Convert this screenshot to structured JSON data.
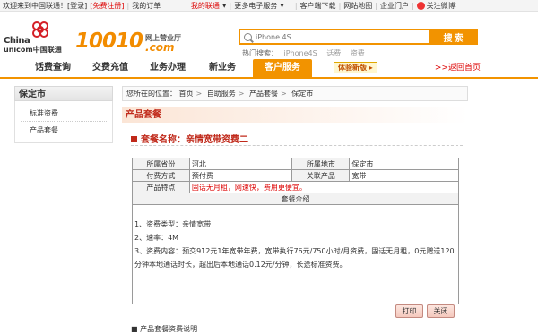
{
  "topbar": {
    "welcome": "欢迎来到中国联通！",
    "login": "[登录]",
    "register": "[免费注册]",
    "my_order": "我的订单",
    "my_unicom": "我的联通",
    "more_services": "更多电子服务",
    "client_download": "客户端下载",
    "sitemap": "网站地图",
    "enterprise": "企业门户",
    "weibo": "关注微博"
  },
  "header": {
    "logo_china": "China",
    "logo_unicom": "unicom中国联通",
    "brand_num": "10010",
    "brand_cn": "网上营业厅",
    "brand_com": ".com",
    "search_placeholder": "iPhone 4S",
    "search_button": "搜索",
    "hot_label": "热门搜索：",
    "hot_words": [
      "iPhone4S",
      "话费",
      "资费"
    ]
  },
  "nav": {
    "items": [
      "话费查询",
      "交费充值",
      "业务办理",
      "新业务",
      "客户服务"
    ],
    "active_index": 4,
    "promo": "体验新版 ▸",
    "back_home": ">>返回首页"
  },
  "sidebar": {
    "title": "保定市",
    "items": [
      "标准资费",
      "产品套餐"
    ]
  },
  "breadcrumb": {
    "prefix": "您所在的位置：",
    "items": [
      "首页",
      "自助服务",
      "产品套餐",
      "保定市"
    ]
  },
  "section": {
    "title": "产品套餐",
    "package_name": "套餐名称：亲情宽带资费二"
  },
  "info_table": {
    "province_label": "所属省份",
    "province_value": "河北",
    "city_label": "所属地市",
    "city_value": "保定市",
    "payment_label": "付费方式",
    "payment_value": "预付费",
    "related_label": "关联产品",
    "related_value": "宽带",
    "feature_label": "产品特点",
    "feature_value": "固话无月租，网速快，费用更便宜。",
    "intro_label": "套餐介绍",
    "intro_lines": [
      "1、资费类型：亲情宽带",
      "2、速率：4M",
      "3、资费内容：预交912元1年宽带年费，宽带执行76元/750小时/月资费，固话无月租，0元赠送120分钟本地通话时长，超出后本地通话0.12元/分钟，长途标准资费。"
    ]
  },
  "buttons": {
    "print": "打印",
    "close": "关闭"
  },
  "bottom_note": "■ 产品套餐资费说明",
  "colors": {
    "accent_orange": "#f29300",
    "brand_red": "#c0291a"
  }
}
